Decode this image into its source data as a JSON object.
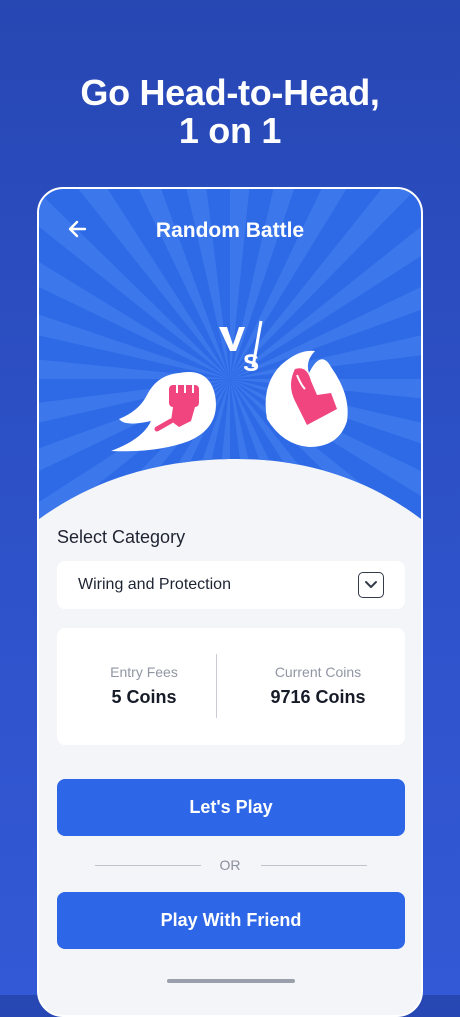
{
  "promo": {
    "headline_line1": "Go Head-to-Head,",
    "headline_line2": "1 on 1"
  },
  "header": {
    "title": "Random Battle",
    "back_icon": "arrow-left-icon"
  },
  "hero": {
    "vs_text": "VS",
    "left_icon": "flaming-fist-icon",
    "right_icon": "flaming-arm-icon"
  },
  "category": {
    "label": "Select Category",
    "selected": "Wiring and Protection",
    "dropdown_icon": "chevron-down-icon"
  },
  "stats": {
    "entry_label": "Entry Fees",
    "entry_value": "5 Coins",
    "coins_label": "Current Coins",
    "coins_value": "9716 Coins"
  },
  "actions": {
    "play_label": "Let's Play",
    "or_label": "OR",
    "friend_label": "Play With Friend"
  },
  "colors": {
    "brand_blue": "#2d66e6",
    "hero_blue": "#2f6ae6",
    "accent_pink": "#f0457f"
  }
}
